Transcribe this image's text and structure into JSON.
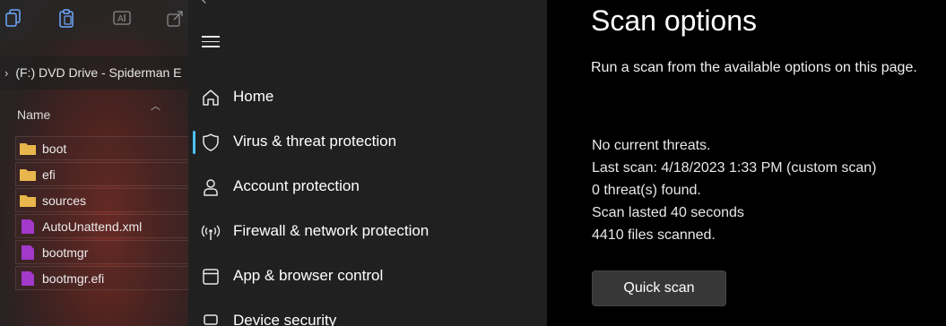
{
  "explorer": {
    "toolbar_icons": [
      "copy-icon",
      "paste-icon",
      "rename-icon",
      "share-icon"
    ],
    "path_label": "(F:) DVD Drive - Spiderman E",
    "column_name": "Name",
    "files": [
      {
        "name": "boot",
        "type": "folder"
      },
      {
        "name": "efi",
        "type": "folder"
      },
      {
        "name": "sources",
        "type": "folder"
      },
      {
        "name": "AutoUnattend.xml",
        "type": "file"
      },
      {
        "name": "bootmgr",
        "type": "file"
      },
      {
        "name": "bootmgr.efi",
        "type": "file"
      }
    ],
    "colors": {
      "folder": "#e8b64c",
      "file": "#a239ca"
    }
  },
  "nav": {
    "items": [
      {
        "label": "Home",
        "icon": "home-icon"
      },
      {
        "label": "Virus & threat protection",
        "icon": "shield-icon",
        "selected": true
      },
      {
        "label": "Account protection",
        "icon": "person-icon"
      },
      {
        "label": "Firewall & network protection",
        "icon": "antenna-icon"
      },
      {
        "label": "App & browser control",
        "icon": "window-icon"
      },
      {
        "label": "Device security",
        "icon": "laptop-icon"
      }
    ],
    "accent": "#4cc2ff"
  },
  "content": {
    "title": "Scan options",
    "description": "Run a scan from the available options on this page.",
    "status_lines": [
      "No current threats.",
      "Last scan: 4/18/2023 1:33 PM (custom scan)",
      "0 threat(s) found.",
      "Scan lasted 40 seconds",
      "4410 files scanned."
    ],
    "quick_scan_label": "Quick scan"
  }
}
